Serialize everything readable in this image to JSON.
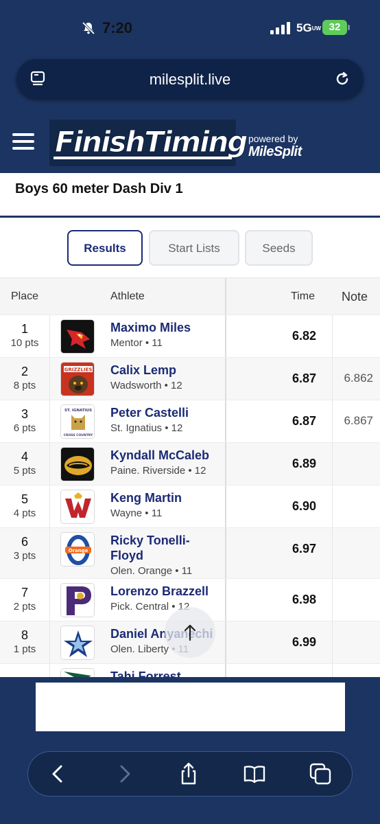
{
  "status_bar": {
    "time": "7:20",
    "network": "5G",
    "network_sub": "UW",
    "battery": "32"
  },
  "browser": {
    "url": "milesplit.live"
  },
  "site": {
    "logo_text": "FinishTiming",
    "powered_by": "powered by",
    "partner": "MileSplit"
  },
  "event": {
    "title": "Boys 60 meter Dash Div 1"
  },
  "tabs": [
    {
      "label": "Results",
      "active": true
    },
    {
      "label": "Start Lists",
      "active": false
    },
    {
      "label": "Seeds",
      "active": false
    }
  ],
  "table": {
    "headers": {
      "place": "Place",
      "athlete": "Athlete",
      "time": "Time",
      "note": "Note"
    },
    "rows": [
      {
        "place": "1",
        "pts": "10 pts",
        "name": "Maximo Miles",
        "school": "Mentor • 11",
        "time": "6.82",
        "note": "",
        "logo": "cardinal-logo"
      },
      {
        "place": "2",
        "pts": "8 pts",
        "name": "Calix Lemp",
        "school": "Wadsworth • 12",
        "time": "6.87",
        "note": "6.862",
        "logo": "grizzlies-logo"
      },
      {
        "place": "3",
        "pts": "6 pts",
        "name": "Peter Castelli",
        "school": "St. Ignatius • 12",
        "time": "6.87",
        "note": "6.867",
        "logo": "st-ignatius-logo"
      },
      {
        "place": "4",
        "pts": "5 pts",
        "name": "Kyndall McCaleb",
        "school": "Paine. Riverside • 12",
        "time": "6.89",
        "note": "",
        "logo": "panther-logo"
      },
      {
        "place": "5",
        "pts": "4 pts",
        "name": "Keng Martin",
        "school": "Wayne • 11",
        "time": "6.90",
        "note": "",
        "logo": "wayne-w-logo"
      },
      {
        "place": "6",
        "pts": "3 pts",
        "name": "Ricky Tonelli-Floyd",
        "school": "Olen. Orange • 11",
        "time": "6.97",
        "note": "",
        "logo": "orange-o-logo"
      },
      {
        "place": "7",
        "pts": "2 pts",
        "name": "Lorenzo Brazzell",
        "school": "Pick. Central • 12",
        "time": "6.98",
        "note": "",
        "logo": "pick-central-p-logo"
      },
      {
        "place": "8",
        "pts": "1 pts",
        "name": "Daniel Anyanechi",
        "school": "Olen. Liberty • 11",
        "time": "6.99",
        "note": "",
        "logo": "liberty-star-logo"
      },
      {
        "place": "",
        "pts": "",
        "name": "Tahj Forrest",
        "school": "",
        "time": "",
        "note": "",
        "logo": "hawk-logo"
      }
    ]
  },
  "colors": {
    "navy": "#1c3461",
    "link": "#1b2a74",
    "battery": "#5ecb5b"
  }
}
